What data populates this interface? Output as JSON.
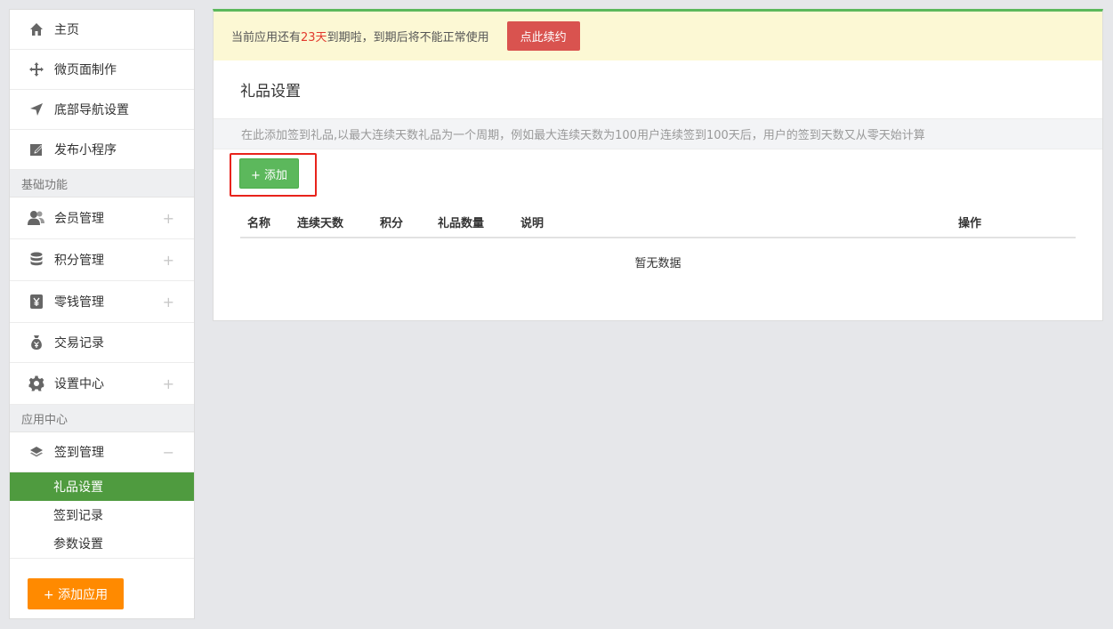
{
  "sidebar": {
    "top_items": [
      {
        "label": "主页",
        "icon": "home-icon"
      },
      {
        "label": "微页面制作",
        "icon": "move-icon"
      },
      {
        "label": "底部导航设置",
        "icon": "navigation-icon"
      },
      {
        "label": "发布小程序",
        "icon": "edit-icon"
      }
    ],
    "section_basic": "基础功能",
    "basic_items": [
      {
        "label": "会员管理",
        "icon": "users-icon",
        "expand": "+"
      },
      {
        "label": "积分管理",
        "icon": "database-icon",
        "expand": "+"
      },
      {
        "label": "零钱管理",
        "icon": "yen-icon",
        "expand": "+"
      },
      {
        "label": "交易记录",
        "icon": "money-bag-icon"
      },
      {
        "label": "设置中心",
        "icon": "gear-icon",
        "expand": "+"
      }
    ],
    "section_app": "应用中心",
    "app_item": {
      "label": "签到管理",
      "icon": "layers-icon",
      "expand": "−"
    },
    "sub_items": [
      "礼品设置",
      "签到记录",
      "参数设置"
    ],
    "add_app_button": "+ 添加应用"
  },
  "notice": {
    "prefix": "当前应用还有",
    "days": "23天",
    "suffix": "到期啦，到期后将不能正常使用",
    "renew_button": "点此续约"
  },
  "main": {
    "title": "礼品设置",
    "description": "在此添加签到礼品,以最大连续天数礼品为一个周期，例如最大连续天数为100用户连续签到100天后，用户的签到天数又从零天始计算",
    "add_button": "+ 添加",
    "columns": [
      "名称",
      "连续天数",
      "积分",
      "礼品数量",
      "说明",
      "操作"
    ],
    "empty_text": "暂无数据"
  },
  "colors": {
    "accent_green": "#5cb85c",
    "active_green": "#4f9b3f",
    "danger_red": "#d9534f",
    "orange": "#ff8a00"
  }
}
